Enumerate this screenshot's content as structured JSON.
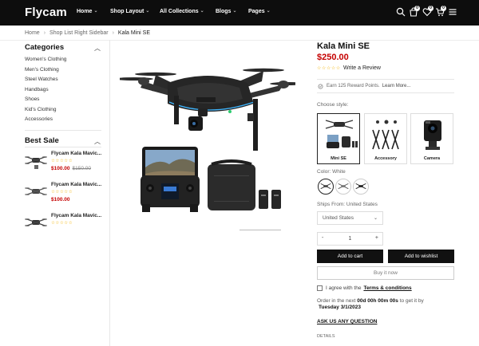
{
  "header": {
    "logo": "Flycam",
    "nav": [
      {
        "label": "Home"
      },
      {
        "label": "Shop Layout"
      },
      {
        "label": "All Collections"
      },
      {
        "label": "Blogs"
      },
      {
        "label": "Pages"
      }
    ],
    "icons": [
      "search-icon",
      "bag-icon",
      "heart-icon",
      "cart-icon",
      "menu-icon"
    ],
    "badges": {
      "bag": "0",
      "heart": "0",
      "cart": "0"
    }
  },
  "breadcrumb": {
    "items": [
      "Home",
      "Shop List Right Sidebar",
      "Kala Mini SE"
    ]
  },
  "sidebar": {
    "categories_title": "Categories",
    "categories": [
      "Women's Clothing",
      "Men's Clothing",
      "Steel Watches",
      "Handbags",
      "Shoes",
      "Kid's Clothing",
      "Accessories"
    ],
    "best_sale_title": "Best Sale",
    "best_sale": [
      {
        "name": "Flycam Kala Mavic...",
        "price": "$100.00",
        "old_price": "$150.00"
      },
      {
        "name": "Flycam Kala Mavic...",
        "price": "$100.00",
        "old_price": ""
      },
      {
        "name": "Flycam Kala Mavic...",
        "price": "",
        "old_price": ""
      }
    ]
  },
  "product": {
    "title": "Kala Mini SE",
    "price": "$250.00",
    "write_review": "Write a Review",
    "reward_text": "Earn 125 Reward Points.",
    "learn_more": "Learn More...",
    "choose_style_label": "Choose style:",
    "styles": [
      {
        "label": "Mini SE",
        "selected": true
      },
      {
        "label": "Accessory",
        "selected": false
      },
      {
        "label": "Camera",
        "selected": false
      }
    ],
    "color_label": "Color: White",
    "ships_label": "Ships From: United States",
    "ships_value": "United States",
    "quantity": "1",
    "add_to_cart": "Add to cart",
    "add_to_wishlist": "Add to wishlist",
    "buy_now": "Buy it now",
    "agree_text": "I agree with the",
    "terms": "Terms & conditions",
    "order_prefix": "Order in the next",
    "countdown": "00d 00h 00m 00s",
    "order_suffix": "to get it by",
    "delivery_date": "Tuesday 3/1/2023",
    "ask_us": "ASK US ANY QUESTION",
    "details": "DETAILS"
  },
  "colors": {
    "header_bg": "#0d0d0d",
    "price_red": "#c50000",
    "star_yellow": "#f3b300",
    "button_dark": "#111111"
  }
}
